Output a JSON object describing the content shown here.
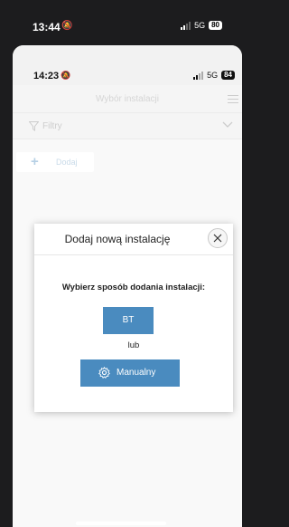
{
  "outer_status": {
    "time": "13:44",
    "network": "5G",
    "battery": "80"
  },
  "inner_status": {
    "time": "14:23",
    "network": "5G",
    "battery": "84"
  },
  "header": {
    "title": "Wybór instalacji"
  },
  "filters": {
    "label": "Filtry"
  },
  "add_button": {
    "label": "Dodaj"
  },
  "modal": {
    "title": "Dodaj nową instalację",
    "prompt": "Wybierz sposób dodania instalacji:",
    "bt_label": "BT",
    "or_label": "lub",
    "manual_label": "Manualny"
  },
  "colors": {
    "accent": "#4a8bbf",
    "background": "#f7f7f7"
  }
}
